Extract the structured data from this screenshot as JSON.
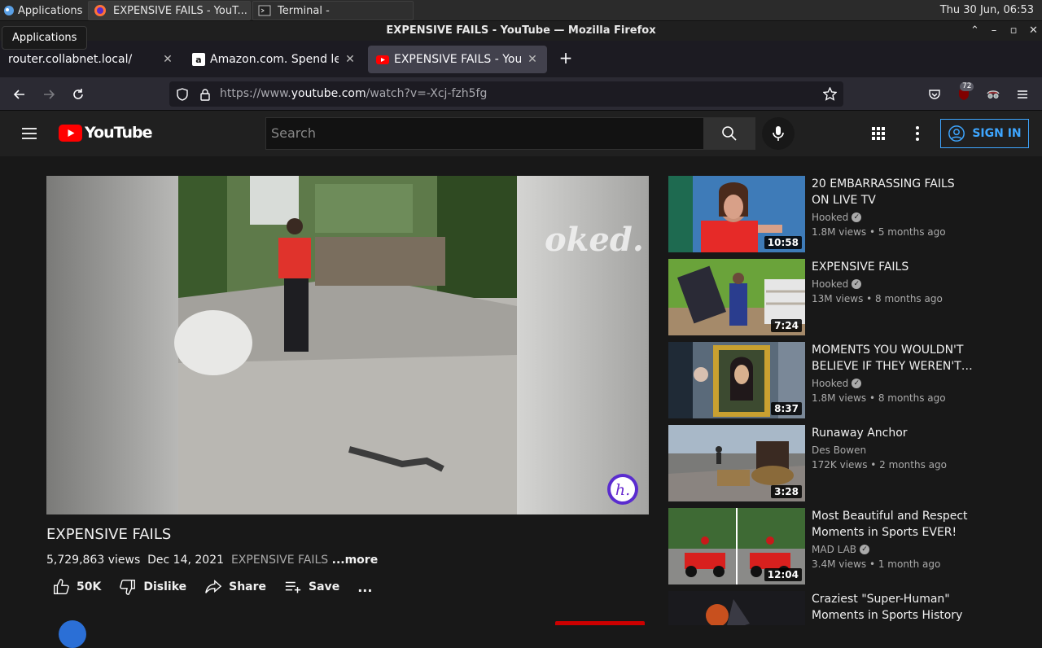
{
  "taskbar": {
    "apps_label": "Applications",
    "tasks": [
      {
        "label": "EXPENSIVE FAILS - YouT...",
        "icon": "firefox-icon",
        "active": true
      },
      {
        "label": "Terminal -",
        "icon": "terminal-icon",
        "active": false
      }
    ],
    "clock": "Thu 30 Jun, 06:53",
    "tooltip": "Applications"
  },
  "window": {
    "title": "EXPENSIVE FAILS - YouTube — Mozilla Firefox"
  },
  "tabs": [
    {
      "label": "router.collabnet.local/",
      "favicon": "none",
      "active": false
    },
    {
      "label": "Amazon.com. Spend less",
      "favicon": "amazon-icon",
      "active": false
    },
    {
      "label": "EXPENSIVE FAILS - YouTu",
      "favicon": "youtube-icon",
      "active": true
    }
  ],
  "navbar": {
    "url_prefix": "https://www.",
    "url_host": "youtube.com",
    "url_path": "/watch?v=-Xcj-fzh5fg",
    "ublock_count": "72"
  },
  "yt": {
    "logo_text": "YouTube",
    "search_placeholder": "Search",
    "signin_label": "SIGN IN"
  },
  "video": {
    "title": "EXPENSIVE FAILS",
    "views": "5,729,863 views",
    "date": "Dec 14, 2021",
    "tagline": "EXPENSIVE FAILS",
    "more": "...more",
    "watermark": "oked.",
    "channel_badge": "h.",
    "like_count": "50K",
    "dislike_label": "Dislike",
    "share_label": "Share",
    "save_label": "Save",
    "more_actions": "..."
  },
  "recommendations": [
    {
      "title": "20 EMBARRASSING FAILS ON LIVE TV",
      "channel": "Hooked",
      "verified": true,
      "stats": "1.8M views • 5 months ago",
      "duration": "10:58"
    },
    {
      "title": "EXPENSIVE FAILS",
      "channel": "Hooked",
      "verified": true,
      "stats": "13M views • 8 months ago",
      "duration": "7:24"
    },
    {
      "title": "MOMENTS YOU WOULDN'T BELIEVE IF THEY WEREN'T…",
      "channel": "Hooked",
      "verified": true,
      "stats": "1.8M views • 8 months ago",
      "duration": "8:37"
    },
    {
      "title": "Runaway Anchor",
      "channel": "Des Bowen",
      "verified": false,
      "stats": "172K views • 2 months ago",
      "duration": "3:28"
    },
    {
      "title": "Most Beautiful and Respect Moments in Sports EVER!",
      "channel": "MAD LAB",
      "verified": true,
      "stats": "3.4M views • 1 month ago",
      "duration": "12:04"
    },
    {
      "title": "Craziest \"Super-Human\" Moments in Sports History",
      "channel": "",
      "verified": false,
      "stats": "",
      "duration": ""
    }
  ],
  "colors": {
    "accent_blue": "#3ea6ff",
    "youtube_red": "#ff0000",
    "page_bg": "#181818"
  }
}
